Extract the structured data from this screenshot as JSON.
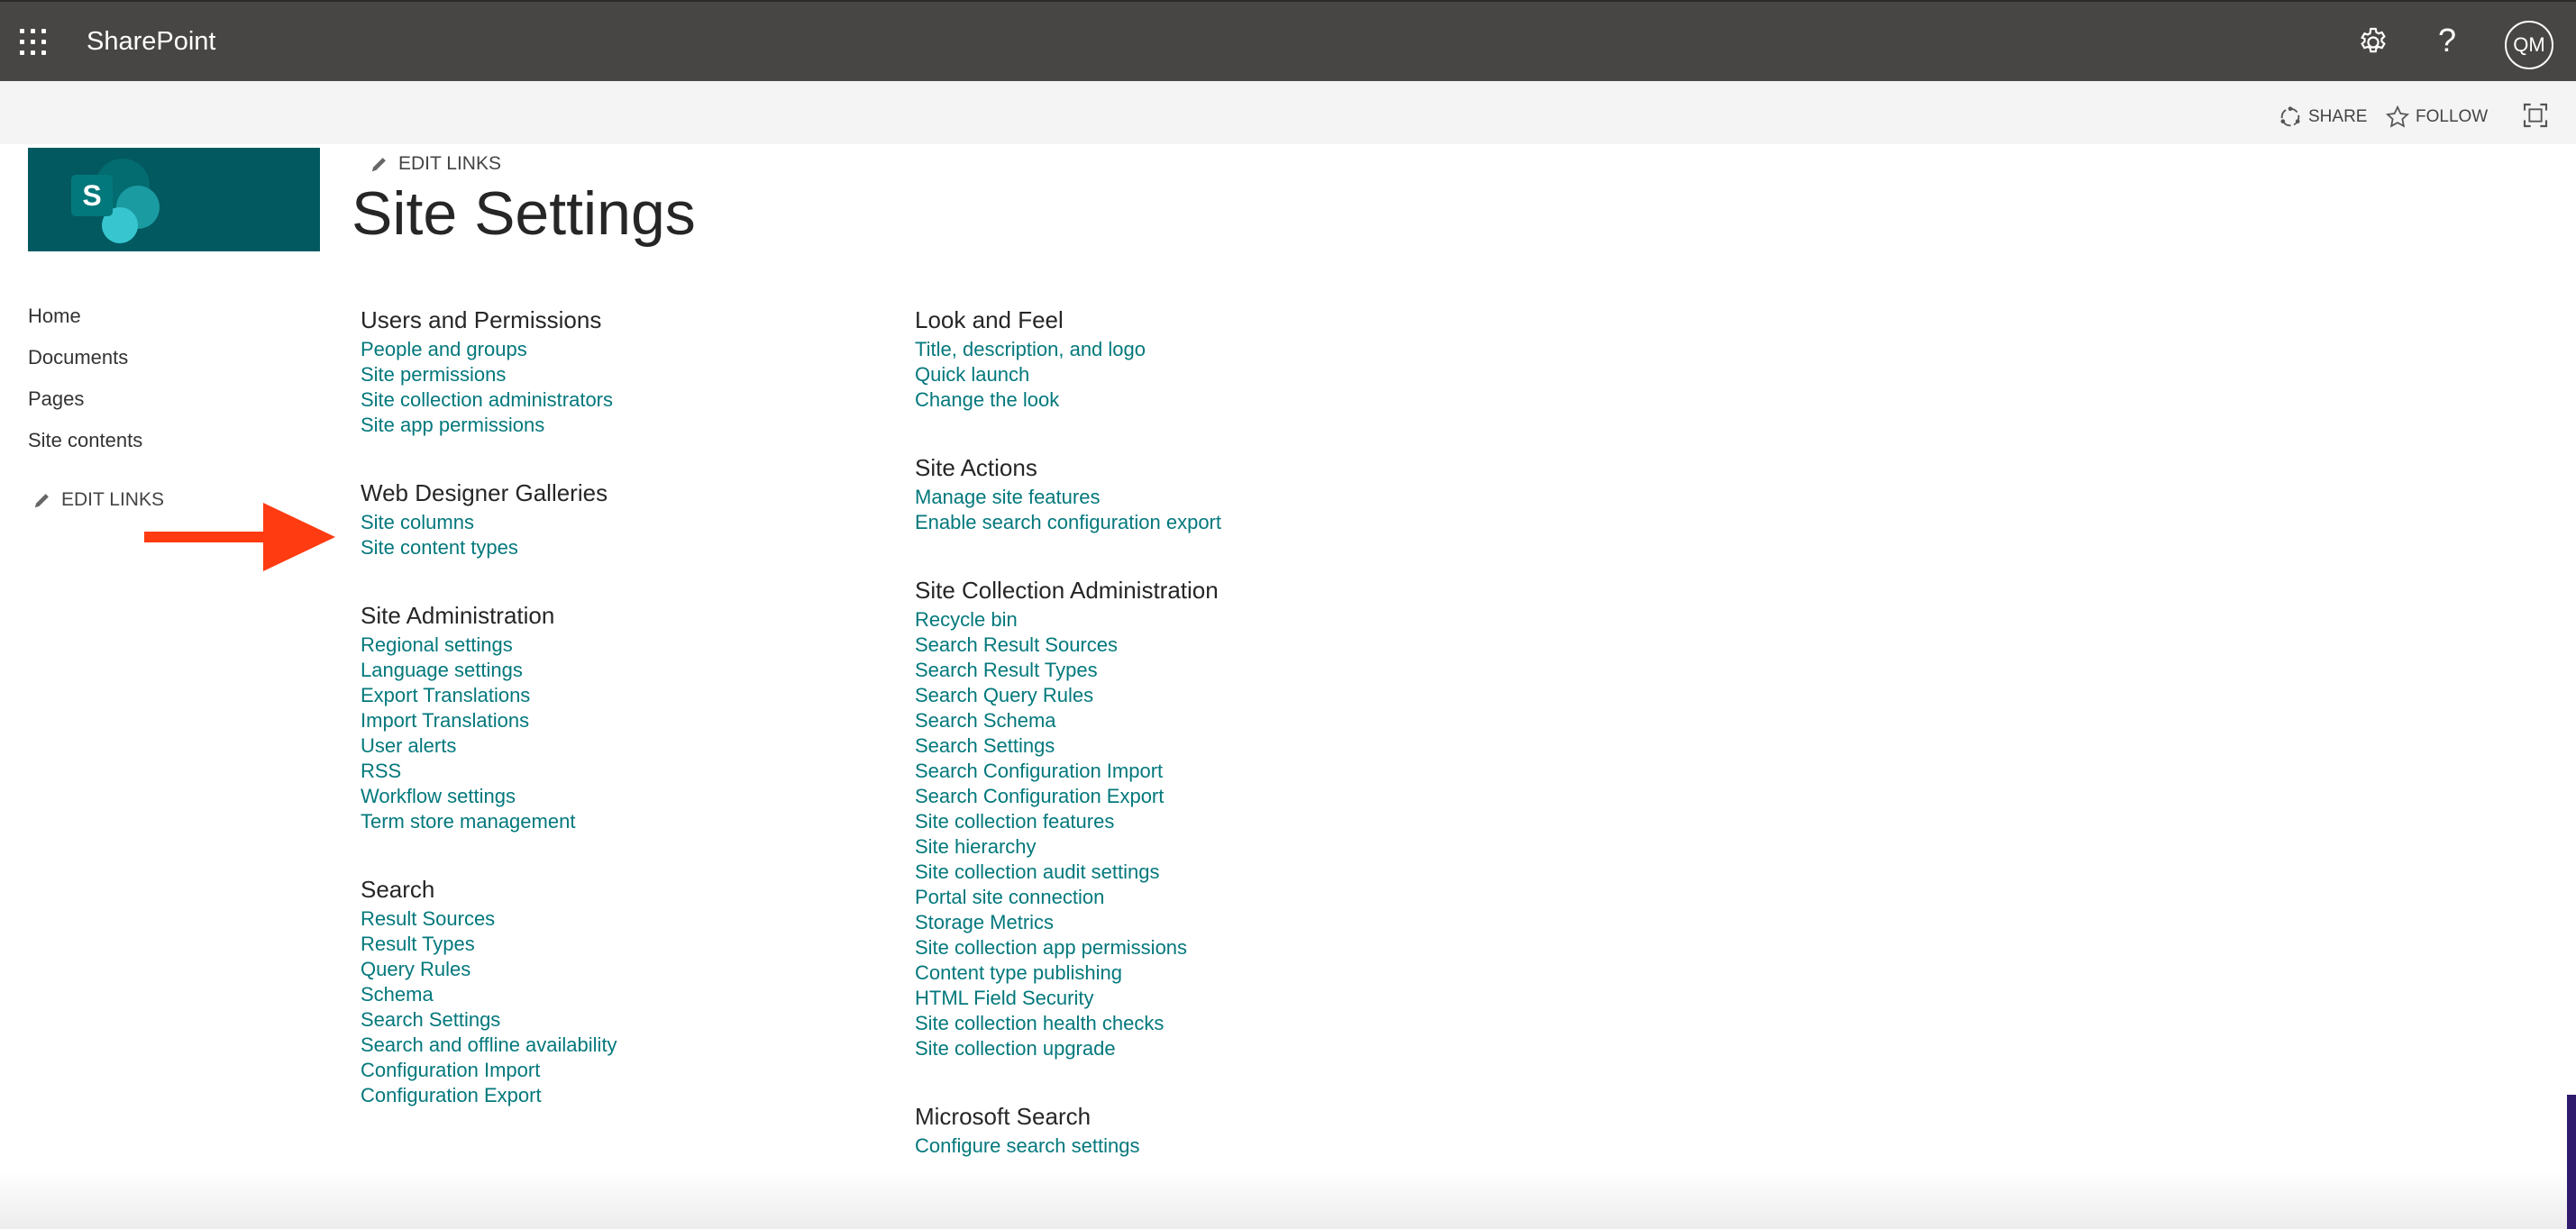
{
  "suitebar": {
    "app_title": "SharePoint",
    "help_label": "?",
    "avatar_initials": "QM"
  },
  "actionbar": {
    "share_label": "SHARE",
    "follow_label": "FOLLOW"
  },
  "header": {
    "edit_links_label": "EDIT LINKS",
    "page_title": "Site Settings"
  },
  "leftnav": {
    "items": [
      "Home",
      "Documents",
      "Pages",
      "Site contents"
    ],
    "edit_links_label": "EDIT LINKS"
  },
  "sections_left": [
    {
      "title": "Users and Permissions",
      "links": [
        "People and groups",
        "Site permissions",
        "Site collection administrators",
        "Site app permissions"
      ]
    },
    {
      "title": "Web Designer Galleries",
      "links": [
        "Site columns",
        "Site content types"
      ]
    },
    {
      "title": "Site Administration",
      "links": [
        "Regional settings",
        "Language settings",
        "Export Translations",
        "Import Translations",
        "User alerts",
        "RSS",
        "Workflow settings",
        "Term store management"
      ]
    },
    {
      "title": "Search",
      "links": [
        "Result Sources",
        "Result Types",
        "Query Rules",
        "Schema",
        "Search Settings",
        "Search and offline availability",
        "Configuration Import",
        "Configuration Export"
      ]
    }
  ],
  "sections_right": [
    {
      "title": "Look and Feel",
      "links": [
        "Title, description, and logo",
        "Quick launch",
        "Change the look"
      ]
    },
    {
      "title": "Site Actions",
      "links": [
        "Manage site features",
        "Enable search configuration export"
      ]
    },
    {
      "title": "Site Collection Administration",
      "links": [
        "Recycle bin",
        "Search Result Sources",
        "Search Result Types",
        "Search Query Rules",
        "Search Schema",
        "Search Settings",
        "Search Configuration Import",
        "Search Configuration Export",
        "Site collection features",
        "Site hierarchy",
        "Site collection audit settings",
        "Portal site connection",
        "Storage Metrics",
        "Site collection app permissions",
        "Content type publishing",
        "HTML Field Security",
        "Site collection health checks",
        "Site collection upgrade"
      ]
    },
    {
      "title": "Microsoft Search",
      "links": [
        "Configure search settings"
      ]
    }
  ],
  "icons": {
    "waffle": "app-launcher-icon",
    "settings": "gear-icon",
    "share": "share-icon",
    "follow": "star-icon",
    "focus": "focus-mode-icon",
    "edit": "pencil-icon",
    "annotation": "arrow-icon"
  },
  "colors": {
    "suitebar": "#484644",
    "link": "#03787c",
    "logo_bg": "#035960",
    "arrow": "#ff3b12"
  }
}
